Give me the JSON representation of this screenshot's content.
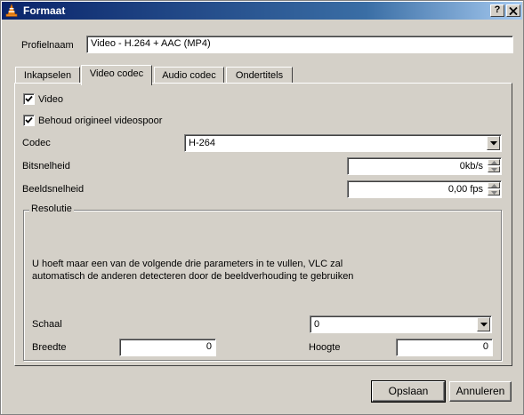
{
  "window": {
    "title": "Formaat",
    "help_label": "?",
    "close_label": "X"
  },
  "profile": {
    "label": "Profielnaam",
    "value": "Video - H.264 + AAC (MP4)"
  },
  "tabs": [
    {
      "label": "Inkapselen"
    },
    {
      "label": "Video codec"
    },
    {
      "label": "Audio codec"
    },
    {
      "label": "Ondertitels"
    }
  ],
  "active_tab": "Video codec",
  "video": {
    "video_label": "Video",
    "video_checked": true,
    "keep_label": "Behoud origineel videospoor",
    "keep_checked": true,
    "codec_label": "Codec",
    "codec_value": "H-264",
    "bitrate_label": "Bitsnelheid",
    "bitrate_value": "0kb/s",
    "framerate_label": "Beeldsnelheid",
    "framerate_value": "0,00 fps"
  },
  "resolution": {
    "group_label": "Resolutie",
    "info_line1": "U hoeft maar een van de volgende drie parameters in te vullen, VLC zal",
    "info_line2": "automatisch de anderen detecteren door de beeldverhouding te gebruiken",
    "scale_label": "Schaal",
    "scale_value": "0",
    "width_label": "Breedte",
    "width_value": "0",
    "height_label": "Hoogte",
    "height_value": "0"
  },
  "buttons": {
    "save_label": "Opslaan",
    "cancel_label": "Annuleren"
  },
  "icons": {
    "app_icon": "vlc-cone-icon",
    "dropdown": "chevron-down-icon",
    "spin_up": "arrow-up-icon",
    "spin_down": "arrow-down-icon",
    "check": "checkmark-icon"
  },
  "colors": {
    "titlebar_start": "#0a246a",
    "titlebar_end": "#a6caf0",
    "dialog_bg": "#d4d0c8",
    "vlc_orange": "#f28c1e"
  }
}
